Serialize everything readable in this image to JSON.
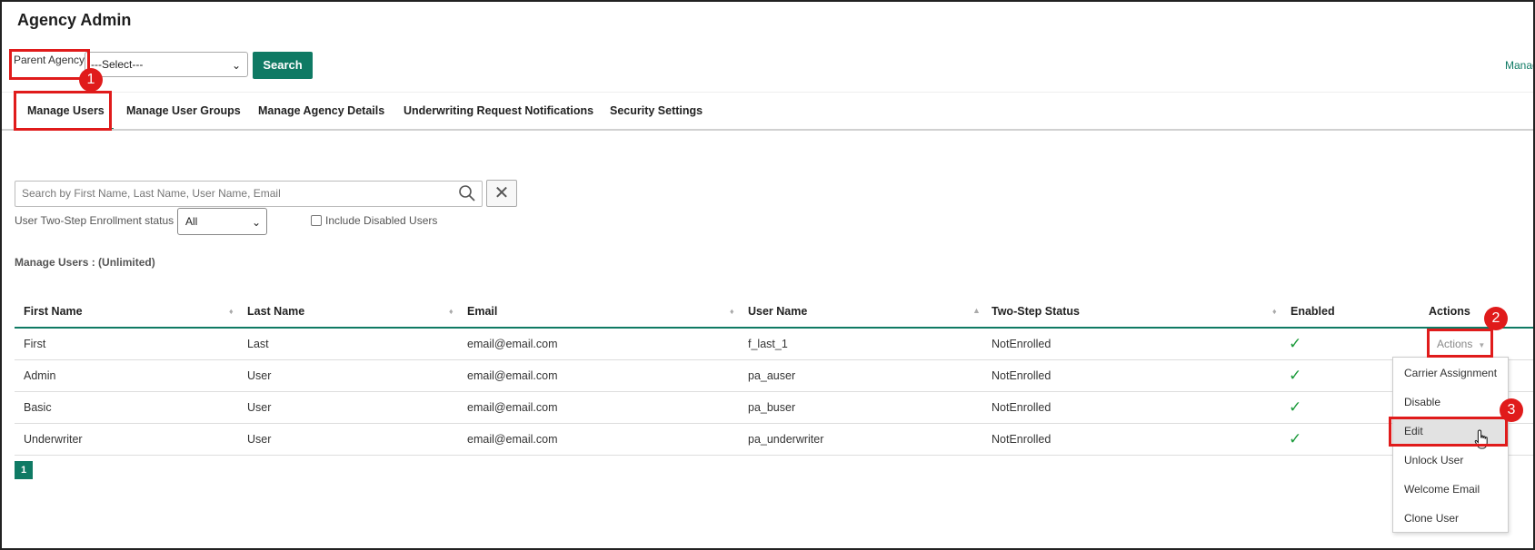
{
  "app": {
    "title": "Agency Admin"
  },
  "filter": {
    "parent_agency_label": "Parent Agency",
    "parent_agency_value": "---Select---",
    "search_label": "Search",
    "manage_link": "Manag"
  },
  "tabs": [
    {
      "label": "Manage Users",
      "active": true
    },
    {
      "label": "Manage User Groups",
      "active": false
    },
    {
      "label": "Manage Agency Details",
      "active": false
    },
    {
      "label": "Underwriting Request Notifications",
      "active": false
    },
    {
      "label": "Security Settings",
      "active": false
    }
  ],
  "user_search": {
    "placeholder": "Search by First Name, Last Name, User Name, Email",
    "clear_label": "✕",
    "enrollment_label": "User Two-Step Enrollment status",
    "enrollment_value": "All",
    "include_disabled_label": "Include Disabled Users",
    "include_disabled_checked": false
  },
  "section": {
    "title": "Manage Users : (Unlimited)"
  },
  "table": {
    "columns": [
      "First Name",
      "Last Name",
      "Email",
      "User Name",
      "Two-Step Status",
      "Enabled",
      "Actions"
    ],
    "rows": [
      {
        "first": "First",
        "last": "Last",
        "email": "email@email.com",
        "username": "f_last_1",
        "status": "NotEnrolled",
        "enabled": "✓"
      },
      {
        "first": "Admin",
        "last": "User",
        "email": "email@email.com",
        "username": "pa_auser",
        "status": "NotEnrolled",
        "enabled": "✓"
      },
      {
        "first": "Basic",
        "last": "User",
        "email": "email@email.com",
        "username": "pa_buser",
        "status": "NotEnrolled",
        "enabled": "✓"
      },
      {
        "first": "Underwriter",
        "last": "User",
        "email": "email@email.com",
        "username": "pa_underwriter",
        "status": "NotEnrolled",
        "enabled": "✓"
      }
    ],
    "actions_label": "Actions"
  },
  "pagination": {
    "current": "1"
  },
  "actions_menu": {
    "items": [
      "Carrier Assignment",
      "Disable",
      "Edit",
      "Unlock User",
      "Welcome Email",
      "Clone User"
    ],
    "hovered": "Edit"
  },
  "annotations": {
    "badge_1": "1",
    "badge_2": "2",
    "badge_3": "3"
  },
  "colors": {
    "accent": "#0f7a64",
    "highlight": "#e01b1b",
    "check": "#1a9a3a"
  }
}
